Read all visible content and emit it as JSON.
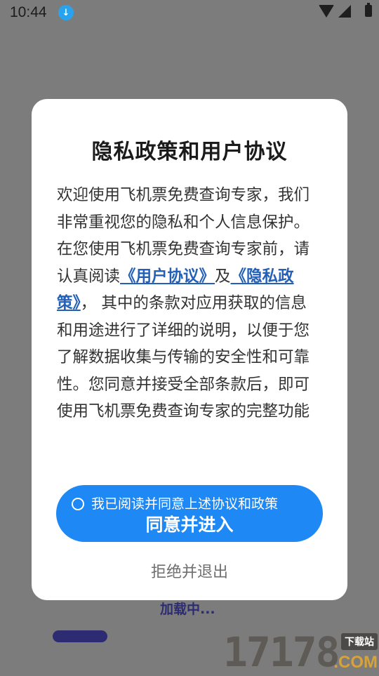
{
  "status_bar": {
    "time": "10:44",
    "icons": [
      "download-icon",
      "wifi-icon",
      "signal-icon",
      "battery-icon"
    ]
  },
  "background": {
    "loading_text": "加载中...",
    "watermark": {
      "number": "17178",
      "tag": "下载站",
      "domain": ".COM"
    }
  },
  "dialog": {
    "title": "隐私政策和用户协议",
    "body_prefix": "欢迎使用飞机票免费查询专家，我们非常重视您的隐私和个人信息保护。在您使用飞机票免费查询专家前，请认真阅读",
    "user_agreement_link": "《用户协议》",
    "conjunction": "及",
    "privacy_link": "《隐私政策》",
    "body_suffix": "， 其中的条款对应用获取的信息和用途进行了详细的说明，以便于您了解数据收集与传输的安全性和可靠性。您同意并接受全部条款后，即可使用飞机票免费查询专家的完整功能",
    "agree_checkbox_label": "我已阅读并同意上述协议和政策",
    "agree_button_label": "同意并进入",
    "reject_button_label": "拒绝并退出"
  },
  "colors": {
    "accent": "#1e88f5",
    "link": "#2360b8",
    "overlay": "#7c7c7c",
    "loading": "#2d2b72"
  }
}
